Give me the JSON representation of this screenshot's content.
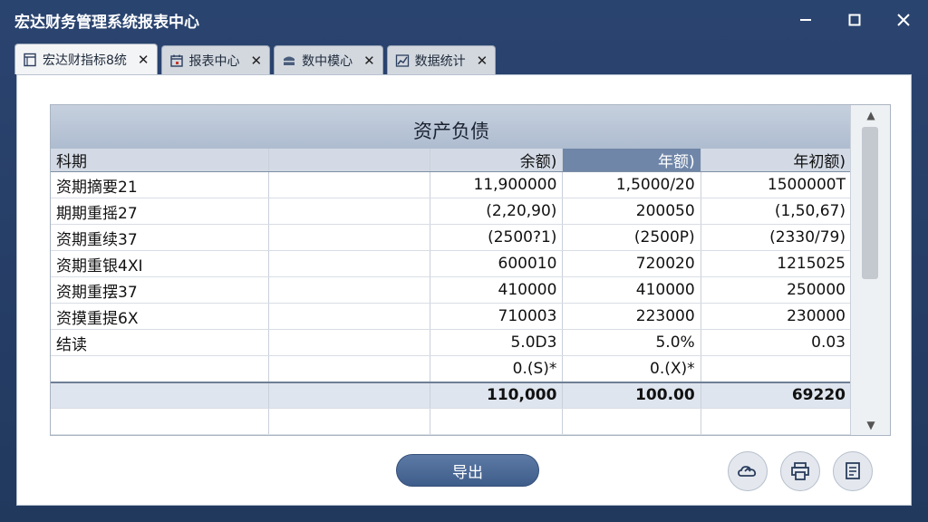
{
  "window": {
    "title": "宏达财务管理系统报表中心"
  },
  "tabs": [
    {
      "label": "宏达财指标8统",
      "icon": "document-icon",
      "active": true
    },
    {
      "label": "报表中心",
      "icon": "calendar-icon",
      "active": false
    },
    {
      "label": "数中模心",
      "icon": "database-icon",
      "active": false
    },
    {
      "label": "数据统计",
      "icon": "chart-icon",
      "active": false
    }
  ],
  "report": {
    "title": "资产负债",
    "columns": [
      "科期",
      "",
      "余额)",
      "年额)",
      "年初额)"
    ],
    "rows": [
      [
        "资期摘要21",
        "",
        "11,900000",
        "1,5000/20",
        "1500000T"
      ],
      [
        "期期重摇27",
        "",
        "(2,20,90)",
        "200050",
        "(1,50,67)"
      ],
      [
        "资期重续37",
        "",
        "(2500?1)",
        "(2500P)",
        "(2330/79)"
      ],
      [
        "资期重银4XI",
        "",
        "600010",
        "720020",
        "1215025"
      ],
      [
        "资期重摆37",
        "",
        "410000",
        "410000",
        "250000"
      ],
      [
        "资摸重提6X",
        "",
        "710003",
        "223000",
        "230000"
      ],
      [
        "结读",
        "",
        "5.0D3",
        "5.0%",
        "0.03"
      ],
      [
        "",
        "",
        "0.(S)*",
        "0.(X)*",
        ""
      ]
    ],
    "total": [
      "",
      "",
      "110,000",
      "100.00",
      "69220"
    ]
  },
  "actions": {
    "export_label": "导出",
    "icons": [
      "cloud-upload-icon",
      "print-icon",
      "notes-icon"
    ]
  }
}
